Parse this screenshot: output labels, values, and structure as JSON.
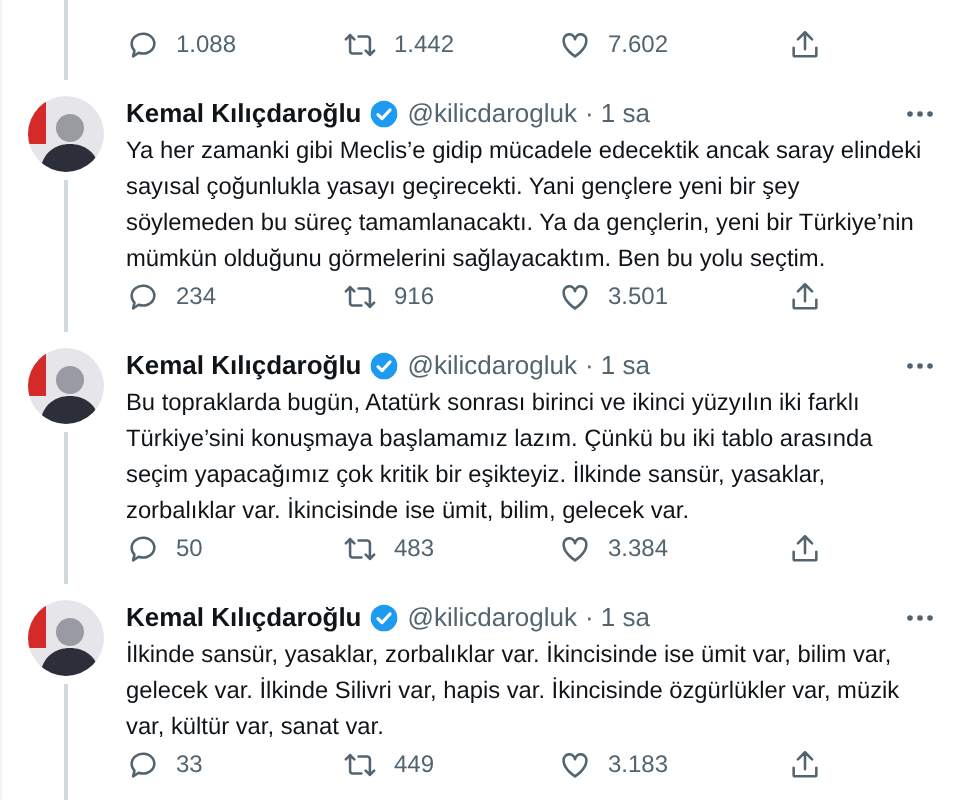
{
  "top_actions": {
    "replies": "1.088",
    "retweets": "1.442",
    "likes": "7.602"
  },
  "tweets": [
    {
      "name": "Kemal Kılıçdaroğlu",
      "handle": "@kilicdarogluk",
      "time": "· 1 sa",
      "verified": true,
      "thread_below": true,
      "text": "Ya her zamanki gibi Meclis’e gidip mücadele edecektik ancak saray elindeki sayısal çoğunlukla yasayı geçirecekti. Yani gençlere yeni bir şey söylemeden bu süreç tamamlanacaktı. Ya da gençlerin, yeni bir Türkiye’nin mümkün olduğunu görmelerini sağlayacaktım. Ben bu yolu seçtim.",
      "replies": "234",
      "retweets": "916",
      "likes": "3.501"
    },
    {
      "name": "Kemal Kılıçdaroğlu",
      "handle": "@kilicdarogluk",
      "time": "· 1 sa",
      "verified": true,
      "thread_below": true,
      "text": "Bu topraklarda bugün, Atatürk sonrası birinci ve ikinci yüzyılın iki farklı Türkiye’sini konuşmaya başlamamız lazım. Çünkü bu iki tablo arasında seçim yapacağımız çok kritik bir eşikteyiz. İlkinde sansür, yasaklar, zorbalıklar var. İkincisinde ise ümit, bilim, gelecek var.",
      "replies": "50",
      "retweets": "483",
      "likes": "3.384"
    },
    {
      "name": "Kemal Kılıçdaroğlu",
      "handle": "@kilicdarogluk",
      "time": "· 1 sa",
      "verified": true,
      "thread_below": true,
      "text": "İlkinde sansür, yasaklar, zorbalıklar var. İkincisinde ise ümit var, bilim var, gelecek var. İlkinde Silivri var, hapis var.  İkincisinde özgürlükler var, müzik var, kültür var, sanat var.",
      "replies": "33",
      "retweets": "449",
      "likes": "3.183"
    }
  ]
}
